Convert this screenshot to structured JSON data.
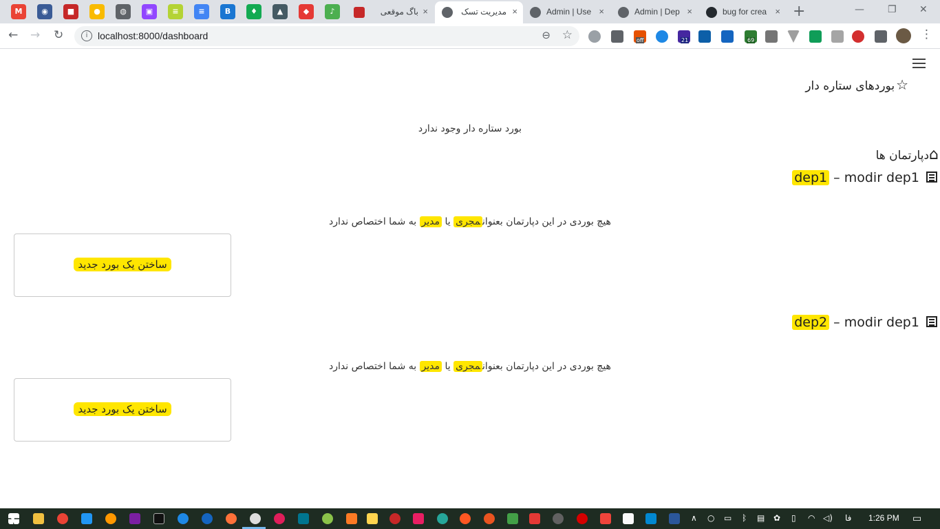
{
  "browser": {
    "pinned_tabs": [
      {
        "icon": "gmail-icon",
        "color": "#ea4335",
        "glyph": "M"
      },
      {
        "icon": "tab-icon-2",
        "color": "#3a5b96",
        "glyph": "◉"
      },
      {
        "icon": "tab-icon-3",
        "color": "#c62828",
        "glyph": "■"
      },
      {
        "icon": "keep-icon",
        "color": "#f9bb00",
        "glyph": "●"
      },
      {
        "icon": "globe-icon",
        "color": "#5f6368",
        "glyph": "◍"
      },
      {
        "icon": "twitch-icon",
        "color": "#9146ff",
        "glyph": "▣"
      },
      {
        "icon": "tab-icon-7",
        "color": "#b4d335",
        "glyph": "≡"
      },
      {
        "icon": "docs-icon",
        "color": "#4285f4",
        "glyph": "≡"
      },
      {
        "icon": "bootstrap-icon",
        "color": "#1976d2",
        "glyph": "B"
      },
      {
        "icon": "mongodb-icon",
        "color": "#13aa52",
        "glyph": "♦"
      },
      {
        "icon": "tab-icon-11",
        "color": "#455a64",
        "glyph": "▲"
      },
      {
        "icon": "tab-icon-12",
        "color": "#e53935",
        "glyph": "◆"
      },
      {
        "icon": "music-icon",
        "color": "#4caf50",
        "glyph": "♪"
      }
    ],
    "tabs": [
      {
        "title": "باگ موقعی",
        "close": "×",
        "active": false
      },
      {
        "title": "مدیریت تسک",
        "close": "×",
        "active": true
      },
      {
        "title": "Admin | Use",
        "close": "×",
        "active": false
      },
      {
        "title": "Admin | Dep",
        "close": "×",
        "active": false
      },
      {
        "title": "bug for crea",
        "close": "×",
        "active": false
      }
    ],
    "new_tab": "+",
    "window_controls": {
      "minimize": "—",
      "restore": "❐",
      "close": "✕"
    },
    "nav": {
      "back": "←",
      "forward": "→",
      "reload": "↻"
    },
    "url": "localhost:8000/dashboard",
    "extension_badges": {
      "off": "off",
      "badge_21": "21",
      "badge_69": "69"
    }
  },
  "page": {
    "starred_heading": "بوردهای ستاره دار",
    "starred_icon": "☆",
    "no_starred_message": "بورد ستاره دار وجود ندارد",
    "departments_heading": "دپارتمان ها",
    "home_icon": "⌂",
    "departments": [
      {
        "name": "dep1",
        "separator": "–",
        "manager": "modir dep1",
        "empty_message": {
          "part1": "هیچ بوردی در این دپارتمان بعنوان",
          "role1": "مجری",
          "or": "یا",
          "role2": "مدیر",
          "part2": "به شما اختصاص ندارد"
        },
        "create_board_label": "ساختن یک بورد جدید"
      },
      {
        "name": "dep2",
        "separator": "–",
        "manager": "modir dep1",
        "empty_message": {
          "part1": "هیچ بوردی در این دپارتمان بعنوان",
          "role1": "مجری",
          "or": "یا",
          "role2": "مدیر",
          "part2": "به شما اختصاص ندارد"
        },
        "create_board_label": "ساختن یک بورد جدید"
      }
    ],
    "highlight_color": "#ffe600"
  },
  "taskbar": {
    "language": "فا",
    "time": "1:26 PM",
    "notification_icon": "notification-icon"
  }
}
